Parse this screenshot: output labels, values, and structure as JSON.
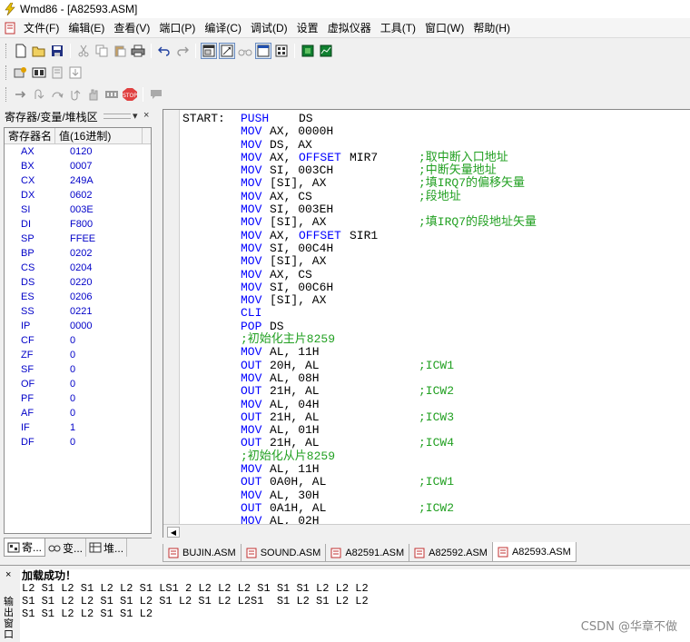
{
  "window": {
    "title": "Wmd86 - [A82593.ASM]"
  },
  "menu": [
    "文件(F)",
    "编辑(E)",
    "查看(V)",
    "端口(P)",
    "编译(C)",
    "调试(D)",
    "设置",
    "虚拟仪器",
    "工具(T)",
    "窗口(W)",
    "帮助(H)"
  ],
  "toolbar_icons": [
    "new-file-icon",
    "open-folder-icon",
    "save-icon",
    "cut-icon",
    "copy-icon",
    "paste-icon",
    "print-icon",
    "undo-icon",
    "redo-icon",
    "window-view-icon",
    "output-window-icon",
    "binocular-icon",
    "register-view-icon",
    "memory-view-icon",
    "chip-icon",
    "monitor-icon"
  ],
  "left_panel": {
    "title": "寄存器/变量/堆栈区",
    "columns": [
      "寄存器名",
      "值(16进制)"
    ],
    "registers": [
      {
        "name": "AX",
        "value": "0120"
      },
      {
        "name": "BX",
        "value": "0007"
      },
      {
        "name": "CX",
        "value": "249A"
      },
      {
        "name": "DX",
        "value": "0602"
      },
      {
        "name": "SI",
        "value": "003E"
      },
      {
        "name": "DI",
        "value": "F800"
      },
      {
        "name": "SP",
        "value": "FFEE"
      },
      {
        "name": "BP",
        "value": "0202"
      },
      {
        "name": "CS",
        "value": "0204"
      },
      {
        "name": "DS",
        "value": "0220"
      },
      {
        "name": "ES",
        "value": "0206"
      },
      {
        "name": "SS",
        "value": "0221"
      },
      {
        "name": "IP",
        "value": "0000"
      },
      {
        "name": "CF",
        "value": "0"
      },
      {
        "name": "ZF",
        "value": "0"
      },
      {
        "name": "SF",
        "value": "0"
      },
      {
        "name": "OF",
        "value": "0"
      },
      {
        "name": "PF",
        "value": "0"
      },
      {
        "name": "AF",
        "value": "0"
      },
      {
        "name": "IF",
        "value": "1"
      },
      {
        "name": "DF",
        "value": "0"
      }
    ],
    "tabs": [
      "寄...",
      "变...",
      "堆..."
    ]
  },
  "code": [
    {
      "label": "START:",
      "op": "PUSH",
      "args": "DS",
      "comment": ""
    },
    {
      "label": "",
      "op": "MOV",
      "args": "AX, 0000H",
      "comment": ""
    },
    {
      "label": "",
      "op": "MOV",
      "args": "DS, AX",
      "comment": ""
    },
    {
      "label": "",
      "op": "MOV",
      "args": "AX,",
      "kw2": "OFFSET",
      "args2": "MIR7",
      "comment": ";取中断入口地址"
    },
    {
      "label": "",
      "op": "MOV",
      "args": "SI, 003CH",
      "comment": ";中断矢量地址"
    },
    {
      "label": "",
      "op": "MOV",
      "args": "[SI], AX",
      "comment": ";填IRQ7的偏移矢量"
    },
    {
      "label": "",
      "op": "MOV",
      "args": "AX, CS",
      "comment": ";段地址"
    },
    {
      "label": "",
      "op": "MOV",
      "args": "SI, 003EH",
      "comment": ""
    },
    {
      "label": "",
      "op": "MOV",
      "args": "[SI], AX",
      "comment": ";填IRQ7的段地址矢量"
    },
    {
      "label": "",
      "op": "MOV",
      "args": "AX,",
      "kw2": "OFFSET",
      "args2": "SIR1",
      "comment": ""
    },
    {
      "label": "",
      "op": "MOV",
      "args": "SI, 00C4H",
      "comment": ""
    },
    {
      "label": "",
      "op": "MOV",
      "args": "[SI], AX",
      "comment": ""
    },
    {
      "label": "",
      "op": "MOV",
      "args": "AX, CS",
      "comment": ""
    },
    {
      "label": "",
      "op": "MOV",
      "args": "SI, 00C6H",
      "comment": ""
    },
    {
      "label": "",
      "op": "MOV",
      "args": "[SI], AX",
      "comment": ""
    },
    {
      "label": "",
      "op": "CLI",
      "args": "",
      "comment": ""
    },
    {
      "label": "",
      "op": "POP",
      "args": "DS",
      "comment": ""
    },
    {
      "label": "",
      "op": "",
      "args": "",
      "line_comment": ";初始化主片8259"
    },
    {
      "label": "",
      "op": "MOV",
      "args": "AL, 11H",
      "comment": ""
    },
    {
      "label": "",
      "op": "OUT",
      "args": "20H, AL",
      "comment": ";ICW1"
    },
    {
      "label": "",
      "op": "MOV",
      "args": "AL, 08H",
      "comment": ""
    },
    {
      "label": "",
      "op": "OUT",
      "args": "21H, AL",
      "comment": ";ICW2"
    },
    {
      "label": "",
      "op": "MOV",
      "args": "AL, 04H",
      "comment": ""
    },
    {
      "label": "",
      "op": "OUT",
      "args": "21H, AL",
      "comment": ";ICW3"
    },
    {
      "label": "",
      "op": "MOV",
      "args": "AL, 01H",
      "comment": ""
    },
    {
      "label": "",
      "op": "OUT",
      "args": "21H, AL",
      "comment": ";ICW4"
    },
    {
      "label": "",
      "op": "",
      "args": "",
      "line_comment": ";初始化从片8259"
    },
    {
      "label": "",
      "op": "MOV",
      "args": "AL, 11H",
      "comment": ""
    },
    {
      "label": "",
      "op": "OUT",
      "args": "0A0H, AL",
      "comment": ";ICW1"
    },
    {
      "label": "",
      "op": "MOV",
      "args": "AL, 30H",
      "comment": ""
    },
    {
      "label": "",
      "op": "OUT",
      "args": "0A1H, AL",
      "comment": ";ICW2"
    },
    {
      "label": "",
      "op": "MOV",
      "args": "AL, 02H",
      "comment": ""
    }
  ],
  "file_tabs": [
    "BUJIN.ASM",
    "SOUND.ASM",
    "A82591.ASM",
    "A82592.ASM",
    "A82593.ASM"
  ],
  "active_file_tab": "A82593.ASM",
  "output": {
    "close": "×",
    "side_label": "输出窗口",
    "lines": [
      "加载成功！",
      "L2 S1 L2 S1 L2 L2 S1 LS1 2 L2 L2 L2 S1 S1 S1 L2 L2 L2",
      "S1 S1 L2 L2 S1 S1 L2 S1 L2 S1 L2 L2S1  S1 L2 S1 L2 L2",
      "S1 S1 L2 L2 S1 S1 L2"
    ]
  },
  "watermark": "CSDN @华章不做"
}
